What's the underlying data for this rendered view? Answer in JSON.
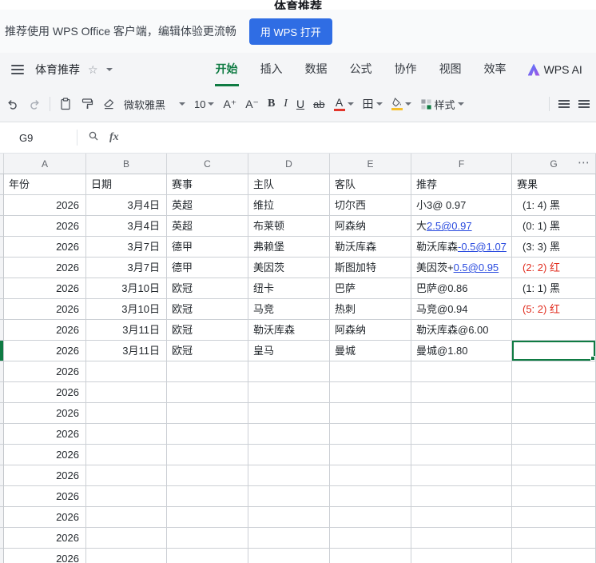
{
  "page": {
    "title": "体育推荐"
  },
  "banner": {
    "text": "推荐使用 WPS Office 客户端，编辑体验更流畅",
    "button": "用 WPS 打开"
  },
  "menu": {
    "doc_title": "体育推荐",
    "tabs": [
      {
        "label": "开始",
        "active": true
      },
      {
        "label": "插入",
        "active": false
      },
      {
        "label": "数据",
        "active": false
      },
      {
        "label": "公式",
        "active": false
      },
      {
        "label": "协作",
        "active": false
      },
      {
        "label": "视图",
        "active": false
      },
      {
        "label": "效率",
        "active": false
      }
    ],
    "wps_ai": "WPS AI"
  },
  "toolbar": {
    "font_name": "微软雅黑",
    "font_size": "10",
    "grow": "A⁺",
    "shrink": "A⁻",
    "bold": "B",
    "italic": "I",
    "underline": "U",
    "strike": "ab",
    "font_color": "A",
    "border": "田",
    "styles": "样式"
  },
  "formula_bar": {
    "fx": "fx"
  },
  "sheet": {
    "name_box": "G9",
    "more": "⋯",
    "selection": "G9",
    "columns": [
      "A",
      "B",
      "C",
      "D",
      "E",
      "F",
      "G"
    ],
    "headers": [
      "年份",
      "日期",
      "赛事",
      "主队",
      "客队",
      "推荐",
      "赛果"
    ],
    "rows": [
      {
        "year": "2026",
        "date": "3月4日",
        "event": "英超",
        "home": "维拉",
        "away": "切尔西",
        "tip": [
          {
            "t": "小3@ 0.97"
          }
        ],
        "result": "(1: 4) 黑",
        "result_color": "black"
      },
      {
        "year": "2026",
        "date": "3月4日",
        "event": "英超",
        "home": "布莱顿",
        "away": "阿森纳",
        "tip": [
          {
            "t": "大"
          },
          {
            "t": "2.5@0.97",
            "link": true
          }
        ],
        "result": "(0: 1) 黑",
        "result_color": "black"
      },
      {
        "year": "2026",
        "date": "3月7日",
        "event": "德甲",
        "home": "弗赖堡",
        "away": "勒沃库森",
        "tip": [
          {
            "t": "勒沃库森"
          },
          {
            "t": "-0.5@1.07",
            "link": true
          }
        ],
        "result": "(3: 3) 黑",
        "result_color": "black"
      },
      {
        "year": "2026",
        "date": "3月7日",
        "event": "德甲",
        "home": "美因茨",
        "away": "斯图加特",
        "tip": [
          {
            "t": "美因茨+"
          },
          {
            "t": "0.5@0.95",
            "link": true
          }
        ],
        "result": "(2: 2) 红",
        "result_color": "red"
      },
      {
        "year": "2026",
        "date": "3月10日",
        "event": "欧冠",
        "home": "纽卡",
        "away": "巴萨",
        "tip": [
          {
            "t": "巴萨@0.86"
          }
        ],
        "result": "(1: 1) 黑",
        "result_color": "black"
      },
      {
        "year": "2026",
        "date": "3月10日",
        "event": "欧冠",
        "home": "马竞",
        "away": "热刺",
        "tip": [
          {
            "t": "马竞@0.94"
          }
        ],
        "result": "(5: 2) 红",
        "result_color": "red"
      },
      {
        "year": "2026",
        "date": "3月11日",
        "event": "欧冠",
        "home": "勒沃库森",
        "away": "阿森纳",
        "tip": [
          {
            "t": "勒沃库森@6.00"
          }
        ],
        "result": "",
        "result_color": "black"
      },
      {
        "year": "2026",
        "date": "3月11日",
        "event": "欧冠",
        "home": "皇马",
        "away": "曼城",
        "tip": [
          {
            "t": "曼城@1.80"
          }
        ],
        "result": "",
        "result_color": "black",
        "selected": true
      },
      {
        "year": "2026"
      },
      {
        "year": "2026"
      },
      {
        "year": "2026"
      },
      {
        "year": "2026"
      },
      {
        "year": "2026"
      },
      {
        "year": "2026"
      },
      {
        "year": "2026"
      },
      {
        "year": "2026"
      },
      {
        "year": "2026"
      },
      {
        "year": "2026"
      }
    ]
  },
  "colors": {
    "accent_green": "#0f7b43",
    "button_blue": "#2f6de4",
    "link_blue": "#2a4bdf",
    "alert_red": "#e12d1f"
  }
}
